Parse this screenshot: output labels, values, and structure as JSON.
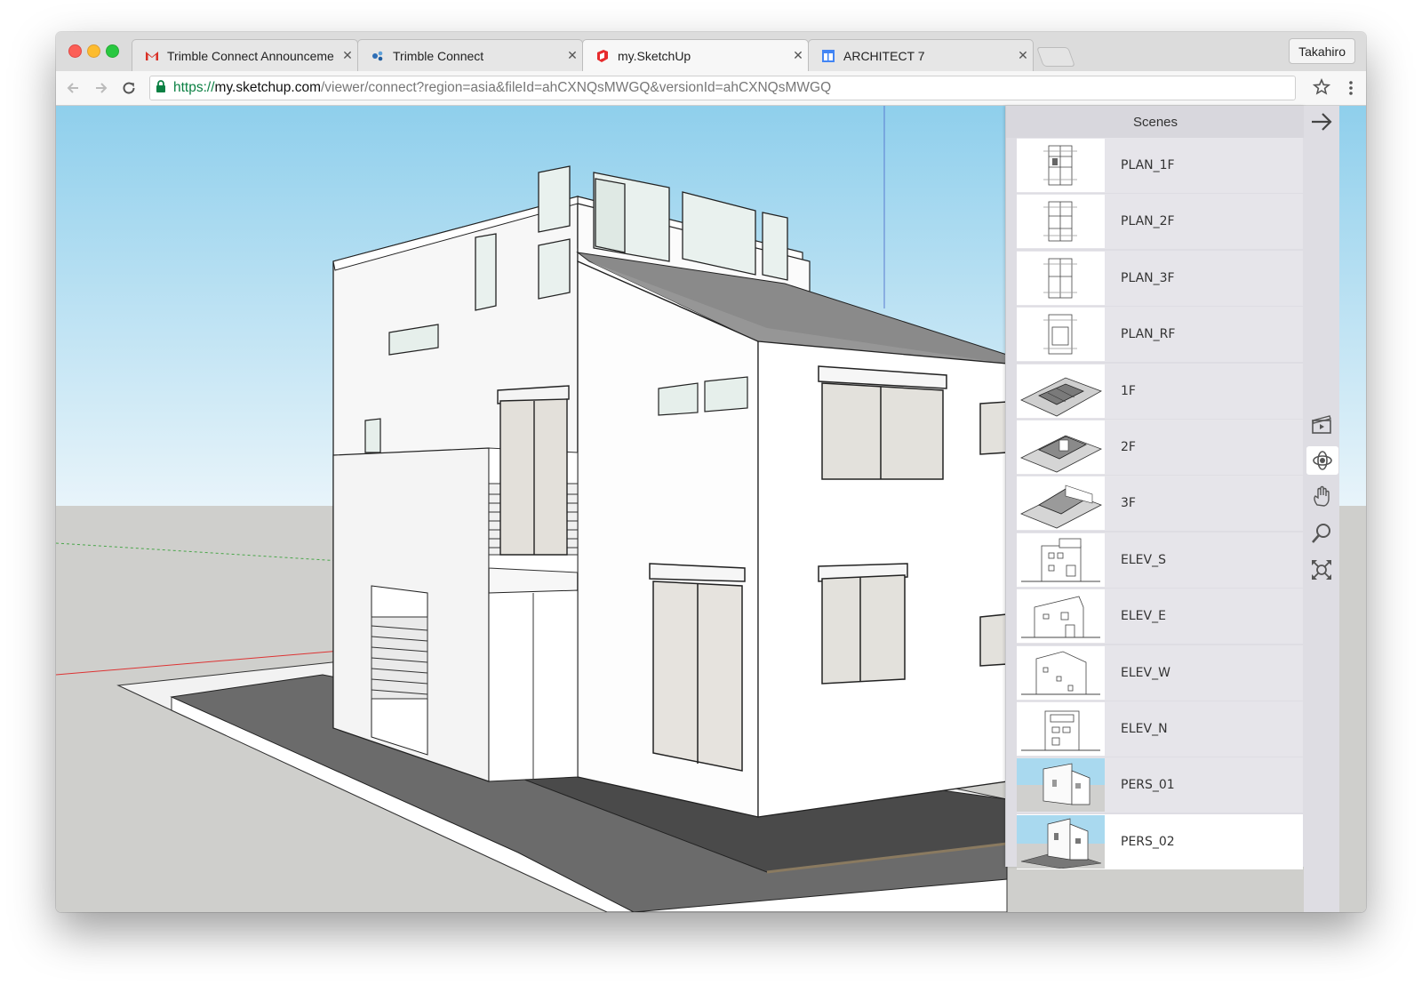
{
  "browser": {
    "tabs": [
      {
        "label": "Trimble Connect Announceme",
        "icon": "gmail-icon",
        "active": false
      },
      {
        "label": "Trimble Connect",
        "icon": "trimble-connect-icon",
        "active": false
      },
      {
        "label": "my.SketchUp",
        "icon": "sketchup-icon",
        "active": true
      },
      {
        "label": "ARCHITECT 7",
        "icon": "google-doc-icon",
        "active": false
      }
    ],
    "profile_name": "Takahiro",
    "url": {
      "scheme": "https://",
      "host": "my.sketchup.com",
      "path": "/viewer/connect?region=asia&fileId=ahCXNQsMWGQ&versionId=ahCXNQsMWGQ"
    }
  },
  "scenes_panel": {
    "title": "Scenes",
    "scenes": [
      {
        "label": "PLAN_1F",
        "thumb": "plan"
      },
      {
        "label": "PLAN_2F",
        "thumb": "plan"
      },
      {
        "label": "PLAN_3F",
        "thumb": "plan"
      },
      {
        "label": "PLAN_RF",
        "thumb": "plan"
      },
      {
        "label": "1F",
        "thumb": "iso"
      },
      {
        "label": "2F",
        "thumb": "iso"
      },
      {
        "label": "3F",
        "thumb": "iso"
      },
      {
        "label": "ELEV_S",
        "thumb": "elev"
      },
      {
        "label": "ELEV_E",
        "thumb": "elev"
      },
      {
        "label": "ELEV_W",
        "thumb": "elev"
      },
      {
        "label": "ELEV_N",
        "thumb": "elev"
      },
      {
        "label": "PERS_01",
        "thumb": "pers"
      },
      {
        "label": "PERS_02",
        "thumb": "pers",
        "selected": true
      }
    ]
  },
  "tools": [
    "collapse-panel-arrow-icon",
    "scenes-clapper-icon",
    "orbit-icon",
    "pan-hand-icon",
    "zoom-magnifier-icon",
    "zoom-extents-icon"
  ],
  "colors": {
    "sky_top": "#9fd5ee",
    "sky_bottom": "#e8f4fa",
    "ground": "#cfcfcc",
    "panel_bg": "#dedde3",
    "url_scheme_green": "#0b8043"
  }
}
